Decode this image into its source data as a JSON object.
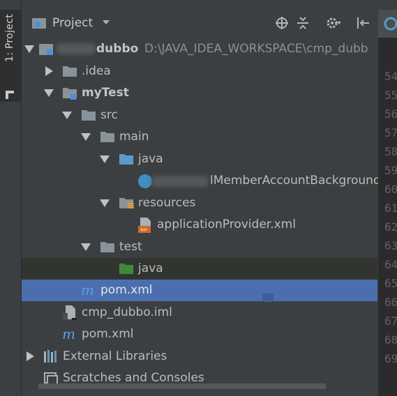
{
  "toolwindow_strip": {
    "tab_label": "1: Project"
  },
  "header": {
    "title": "Project",
    "buttons": [
      "locate-icon",
      "collapse-all-icon",
      "settings-icon",
      "hide-icon"
    ]
  },
  "tree": [
    {
      "label": "dubbo",
      "path": "D:\\JAVA_IDEA_WORKSPACE\\cmp_dubb",
      "icon": "module-icon",
      "state": "root"
    },
    {
      "label": ".idea",
      "icon": "folder-icon",
      "state": "collapsed"
    },
    {
      "label": "myTest",
      "icon": "module-folder-icon",
      "state": "expanded"
    },
    {
      "label": "src",
      "icon": "folder-icon",
      "state": "expanded"
    },
    {
      "label": "main",
      "icon": "folder-icon",
      "state": "expanded"
    },
    {
      "label": "java",
      "icon": "source-folder-icon",
      "state": "expanded"
    },
    {
      "label": "lMemberAccountBackgrounc",
      "icon": "class-icon",
      "state": "leaf"
    },
    {
      "label": "resources",
      "icon": "resources-folder-icon",
      "state": "expanded"
    },
    {
      "label": "applicationProvider.xml",
      "icon": "xml-file-icon",
      "state": "leaf"
    },
    {
      "label": "test",
      "icon": "folder-icon",
      "state": "expanded"
    },
    {
      "label": "java",
      "icon": "test-folder-icon",
      "state": "leaf"
    },
    {
      "label": "pom.xml",
      "icon": "maven-icon",
      "state": "leaf",
      "selected": true
    },
    {
      "label": "cmp_dubbo.iml",
      "icon": "iml-file-icon",
      "state": "leaf"
    },
    {
      "label": "pom.xml",
      "icon": "maven-icon",
      "state": "leaf"
    },
    {
      "label": "External Libraries",
      "icon": "libraries-icon",
      "state": "collapsed"
    },
    {
      "label": "Scratches and Consoles",
      "icon": "scratches-icon",
      "state": "leaf"
    }
  ],
  "line_numbers": [
    "54",
    "55",
    "56",
    "57",
    "58",
    "59",
    "60",
    "61",
    "62",
    "63",
    "64",
    "65",
    "66",
    "67",
    "68",
    "69"
  ],
  "colors": {
    "selection": "#4b6eaf",
    "folder": "#8a9399",
    "source_folder": "#5a9bc7",
    "test_folder": "#3f8a3a",
    "maven": "#4a8fdc"
  }
}
